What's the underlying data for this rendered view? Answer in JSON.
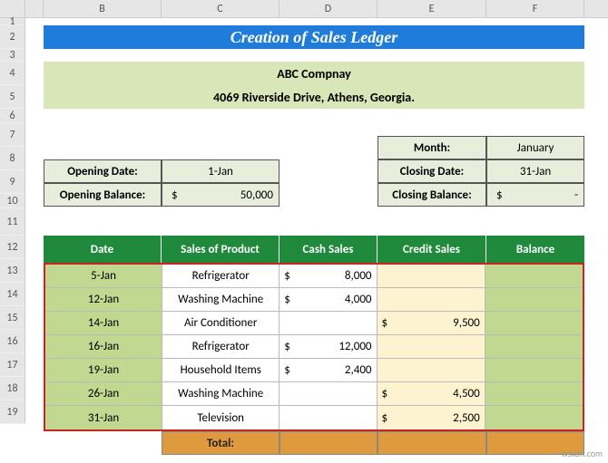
{
  "columns": [
    "B",
    "C",
    "D",
    "E",
    "F"
  ],
  "col_widths": {
    "B": 130,
    "C": 130,
    "D": 108,
    "E": 120,
    "F": 108
  },
  "row_labels": [
    "1",
    "2",
    "3",
    "4",
    "5",
    "6",
    "7",
    "8",
    "9",
    "10",
    "11",
    "12",
    "13",
    "14",
    "15",
    "16",
    "17",
    "18",
    "19"
  ],
  "title": "Creation of Sales Ledger",
  "company": {
    "name": "ABC Compnay",
    "address": "4069 Riverside Drive, Athens, Georgia."
  },
  "opening": {
    "date_label": "Opening Date:",
    "date_value": "1-Jan",
    "bal_label": "Opening Balance:",
    "bal_currency": "$",
    "bal_value": "50,000"
  },
  "closing": {
    "month_label": "Month:",
    "month_value": "January",
    "date_label": "Closing Date:",
    "date_value": "31-Jan",
    "bal_label": "Closing Balance:",
    "bal_currency": "$",
    "bal_value": "-"
  },
  "table": {
    "headers": {
      "date": "Date",
      "product": "Sales of Product",
      "cash": "Cash Sales",
      "credit": "Credit Sales",
      "balance": "Balance"
    },
    "rows": [
      {
        "date": "5-Jan",
        "product": "Refrigerator",
        "cash_cur": "$",
        "cash": "8,000",
        "credit_cur": "",
        "credit": ""
      },
      {
        "date": "12-Jan",
        "product": "Washing Machine",
        "cash_cur": "$",
        "cash": "4,000",
        "credit_cur": "",
        "credit": ""
      },
      {
        "date": "14-Jan",
        "product": "Air Conditioner",
        "cash_cur": "",
        "cash": "",
        "credit_cur": "$",
        "credit": "9,500"
      },
      {
        "date": "16-Jan",
        "product": "Refrigerator",
        "cash_cur": "$",
        "cash": "12,000",
        "credit_cur": "",
        "credit": ""
      },
      {
        "date": "19-Jan",
        "product": "Household Items",
        "cash_cur": "$",
        "cash": "2,400",
        "credit_cur": "",
        "credit": ""
      },
      {
        "date": "26-Jan",
        "product": "Washing Machine",
        "cash_cur": "",
        "cash": "",
        "credit_cur": "$",
        "credit": "4,500"
      },
      {
        "date": "31-Jan",
        "product": "Television",
        "cash_cur": "",
        "cash": "",
        "credit_cur": "$",
        "credit": "2,500"
      }
    ],
    "total_label": "Total:"
  },
  "watermark": "wsxdn.com"
}
